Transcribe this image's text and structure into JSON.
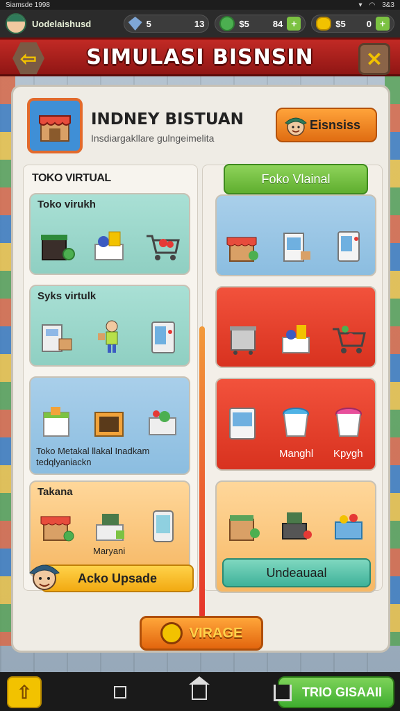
{
  "status": {
    "left": "Siamsde 1998",
    "right": "3&3"
  },
  "resources": {
    "user": "Uodelaishusd",
    "gems": "5",
    "time": "13",
    "money_label": "$5",
    "money": "84",
    "coin_label": "$5",
    "coins": "0"
  },
  "title": "SIMULASI BISNSIN",
  "header": {
    "title": "INDNEY BISTUAN",
    "subtitle": "Insdiargakllare gulngeimelita",
    "bisnis_button": "Eisnsiss"
  },
  "left_column": {
    "title": "TOKO VIRTUAL",
    "cards": [
      {
        "label": "Toko virukh"
      },
      {
        "label": "Syks virtulk"
      },
      {
        "label": "",
        "caption_1": "Toko Metakal llakal Inadkam",
        "caption_2": "tedqlyaniackn"
      },
      {
        "label": "Takana",
        "caption": "Maryani"
      }
    ],
    "upgrade_button": "Acko Upsade"
  },
  "right_column": {
    "top_button": "Foko Vlainal",
    "card3_labels": [
      "Manghl",
      "Kpygh"
    ],
    "bottom_button": "Undeauaal"
  },
  "virage_button": "VIRAGE",
  "nav": {
    "trio_button": "TRIO GISAAII"
  },
  "colors": {
    "title_red": "#c22a25",
    "accent_orange": "#e06d12",
    "accent_green": "#5fae2f"
  }
}
